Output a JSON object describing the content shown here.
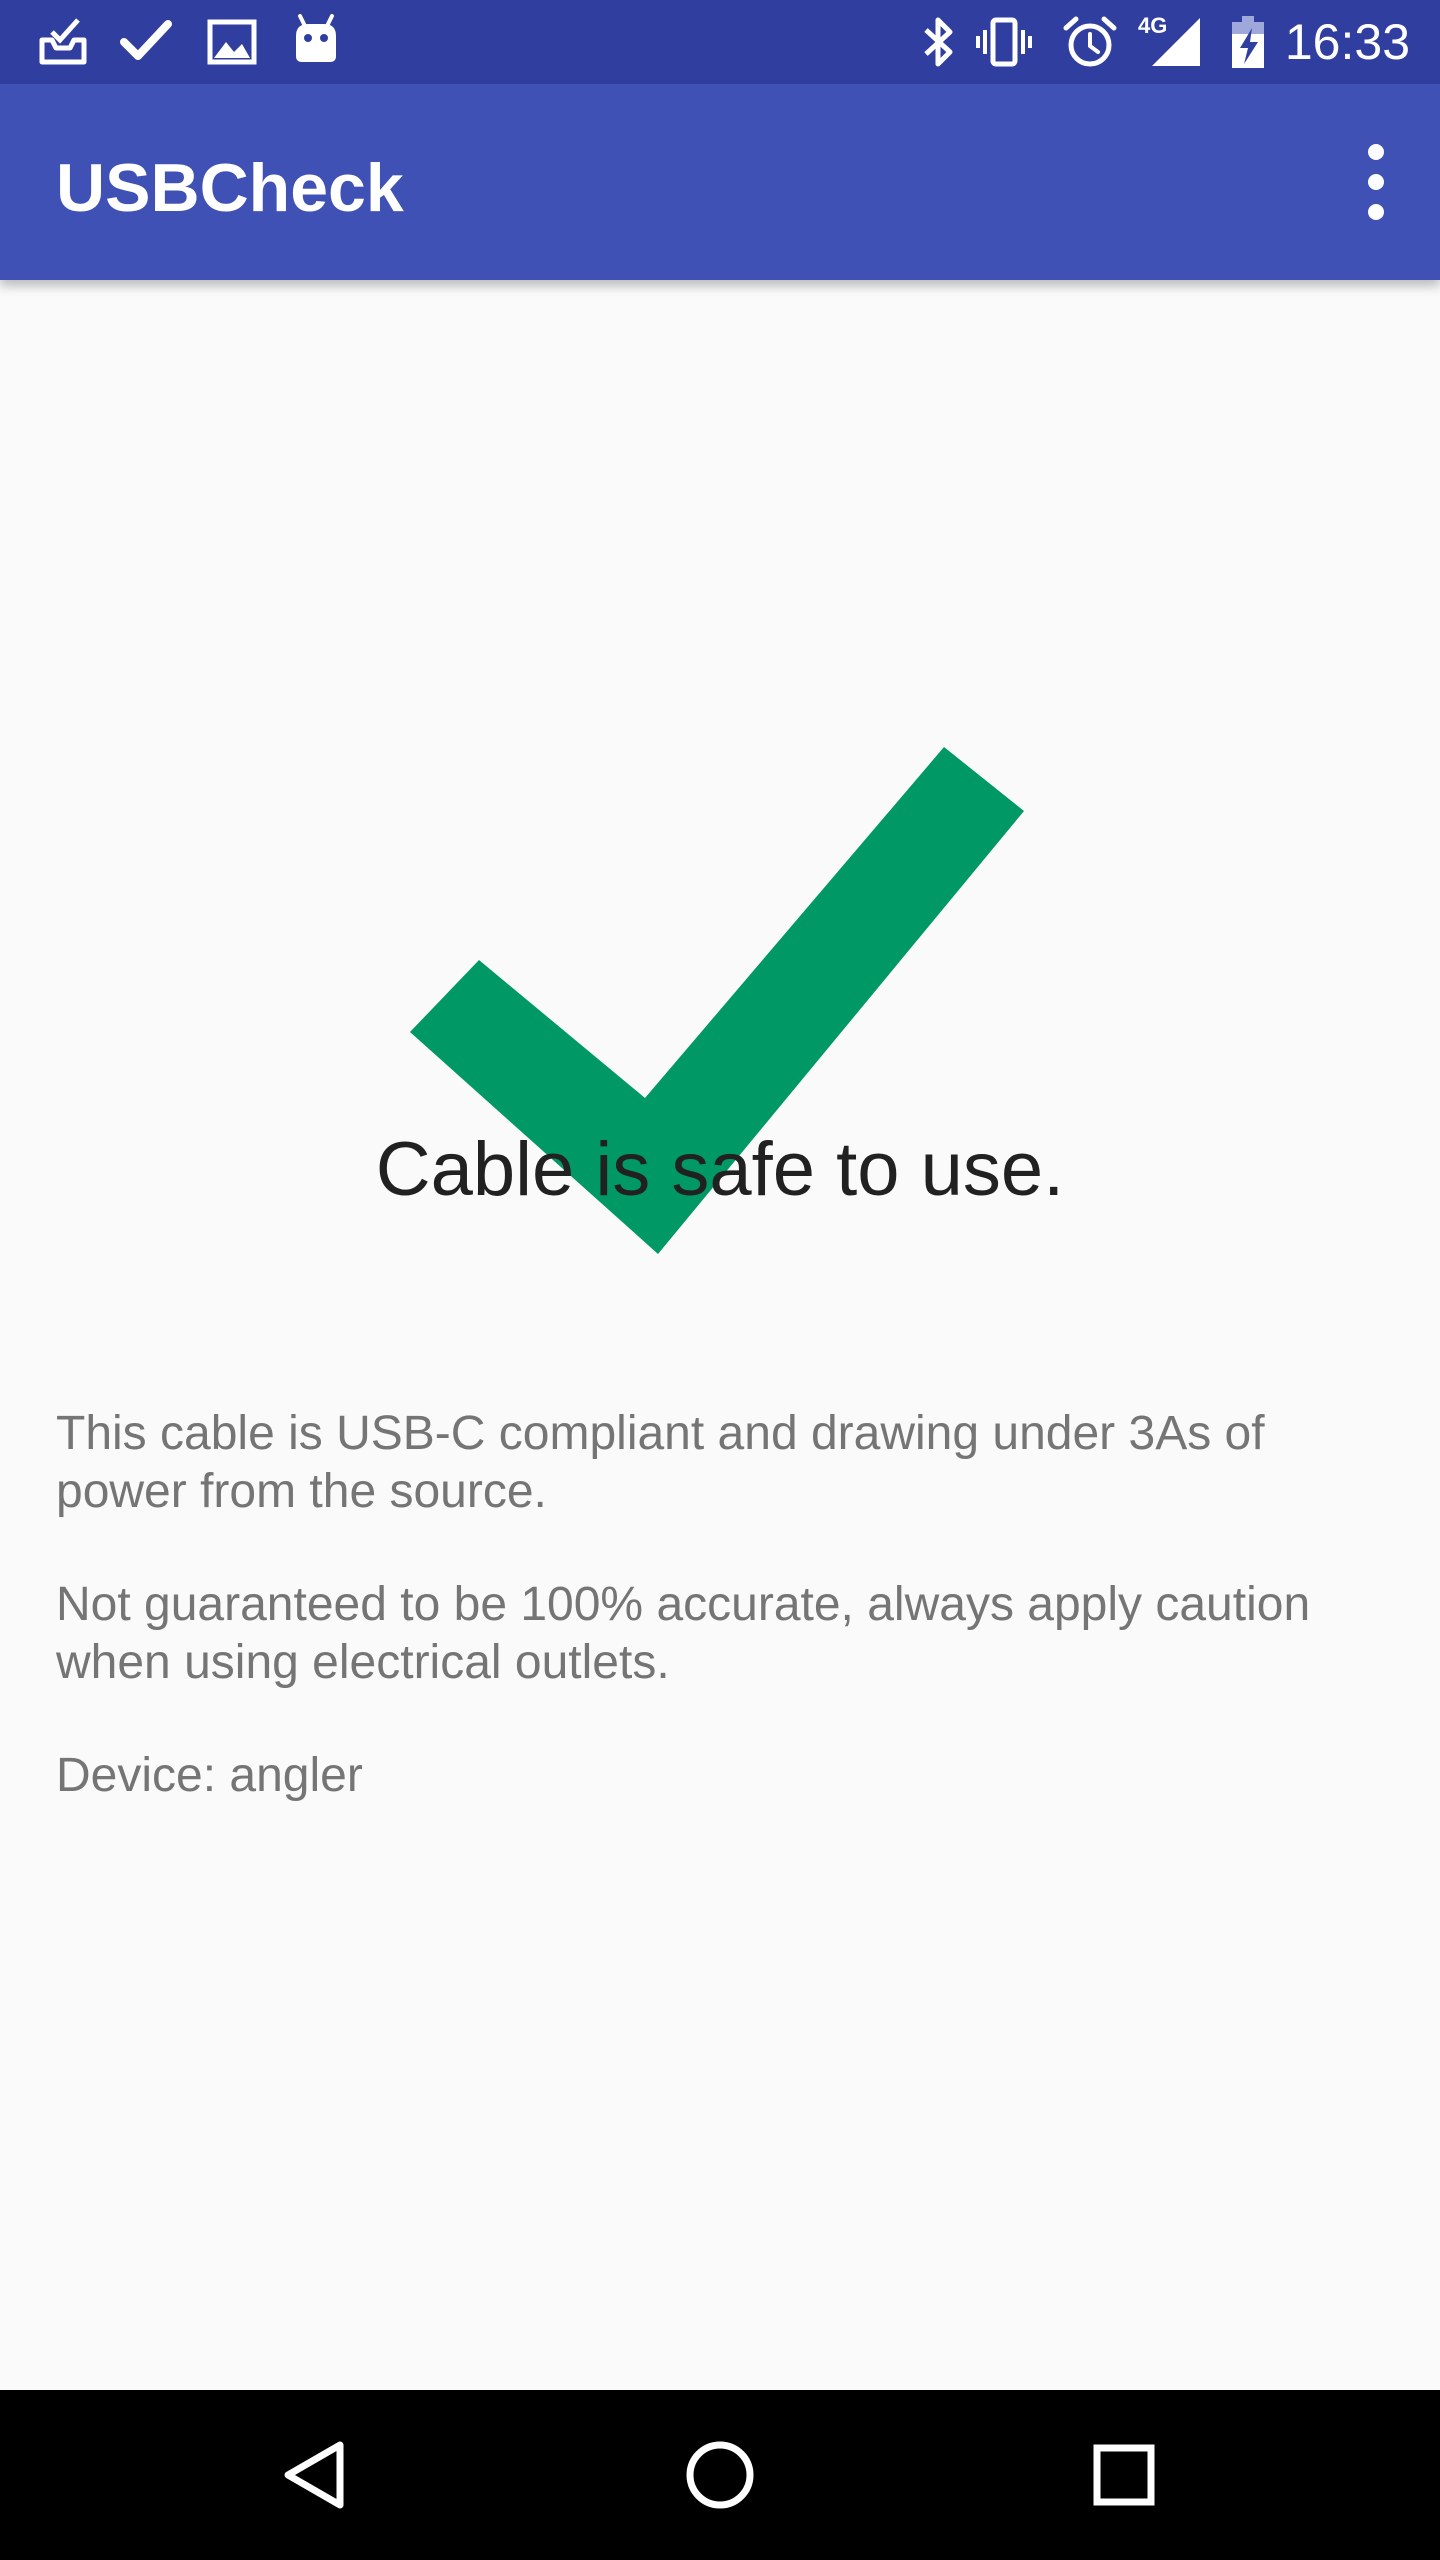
{
  "status_bar": {
    "time": "16:33",
    "network_label": "4G",
    "notification_icons": [
      "inbox-tray-icon",
      "checkmark-icon",
      "image-icon",
      "android-icon"
    ],
    "system_icons": [
      "bluetooth-icon",
      "vibrate-icon",
      "alarm-icon",
      "signal-4g-icon",
      "battery-charging-icon"
    ]
  },
  "app_bar": {
    "title": "USBCheck",
    "overflow_icon": "more-vertical-icon"
  },
  "result": {
    "icon": "checkmark-icon",
    "icon_color": "#009966",
    "headline": "Cable is safe to use."
  },
  "details": {
    "compliance": "This cable is USB-C compliant and drawing under 3As of power from the source.",
    "disclaimer": "Not guaranteed to be 100% accurate, always apply caution when using electrical outlets.",
    "device": "Device: angler"
  },
  "nav_bar": {
    "buttons": [
      "back-icon",
      "home-icon",
      "recents-icon"
    ]
  },
  "colors": {
    "primary": "#3f51b5",
    "primary_dark": "#303f9f",
    "background": "#fafafa",
    "success": "#009966",
    "text_primary": "#212121",
    "text_secondary": "#757575"
  }
}
